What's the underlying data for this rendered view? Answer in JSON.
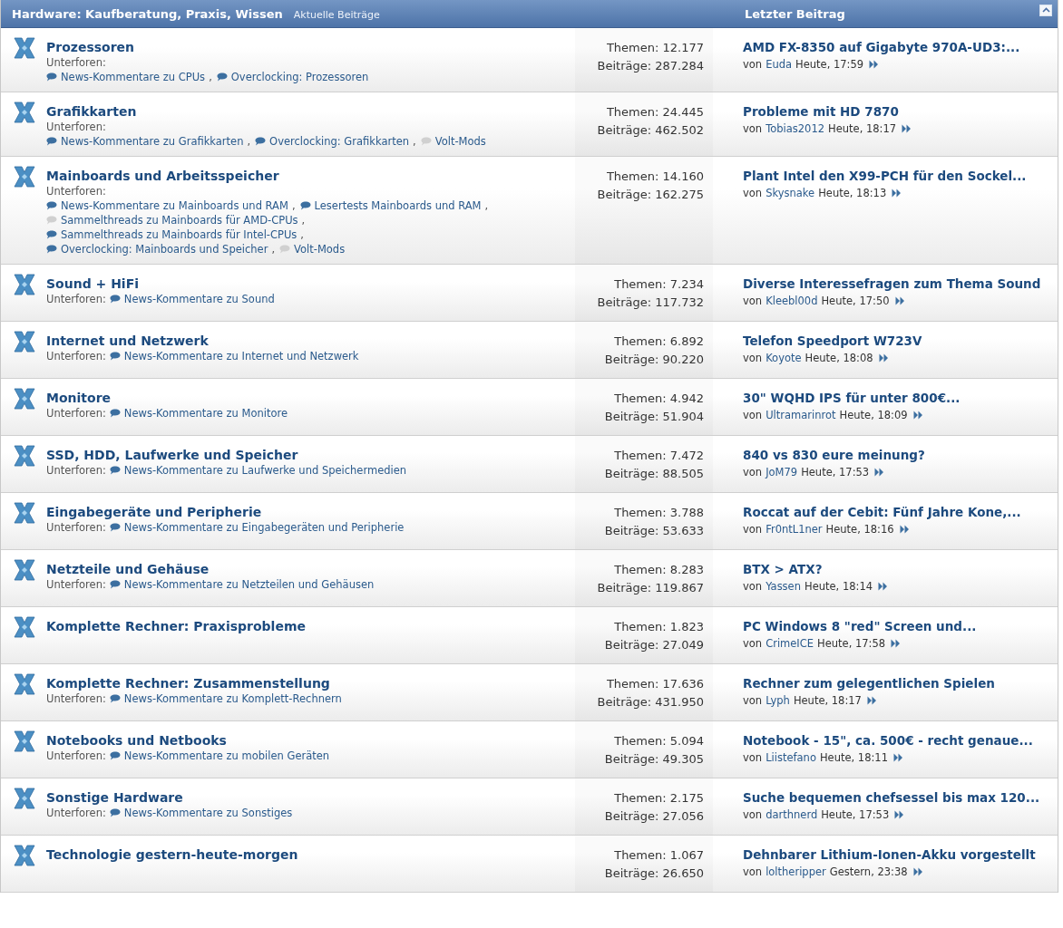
{
  "header": {
    "title": "Hardware: Kaufberatung, Praxis, Wissen",
    "link": "Aktuelle Beiträge",
    "last_post_heading": "Letzter Beitrag"
  },
  "forums": [
    {
      "name": "Prozessoren",
      "subforum_label": "Unterforen:",
      "label_on_own_line": true,
      "subforums": [
        {
          "name": "News-Kommentare zu CPUs",
          "unread": true,
          "separator": ","
        },
        {
          "name": "Overclocking: Prozessoren",
          "unread": true
        }
      ],
      "topics": "Themen: 12.177",
      "posts": "Beiträge: 287.284",
      "last_post": {
        "title": "AMD FX-8350 auf Gigabyte 970A-UD3:...",
        "by": "von",
        "author": "Euda",
        "time": "Heute, 17:59"
      }
    },
    {
      "name": "Grafikkarten",
      "subforum_label": "Unterforen:",
      "label_on_own_line": true,
      "subforums": [
        {
          "name": "News-Kommentare zu Grafikkarten",
          "unread": true,
          "separator": ","
        },
        {
          "name": "Overclocking: Grafikkarten",
          "unread": true,
          "separator": ","
        },
        {
          "name": "Volt-Mods",
          "unread": false
        }
      ],
      "topics": "Themen: 24.445",
      "posts": "Beiträge: 462.502",
      "last_post": {
        "title": "Probleme mit HD 7870",
        "by": "von",
        "author": "Tobias2012",
        "time": "Heute, 18:17"
      }
    },
    {
      "name": "Mainboards und Arbeitsspeicher",
      "subforum_label": "Unterforen:",
      "label_on_own_line": true,
      "subforums": [
        {
          "name": "News-Kommentare zu Mainboards und RAM",
          "unread": true,
          "separator": ","
        },
        {
          "name": "Lesertests Mainboards und RAM",
          "unread": true,
          "separator": ","
        },
        {
          "name": "Sammelthreads zu Mainboards für AMD-CPUs",
          "unread": false,
          "separator": ","
        },
        {
          "name": "Sammelthreads zu Mainboards für Intel-CPUs",
          "unread": true,
          "separator": ","
        },
        {
          "name": "Overclocking: Mainboards und Speicher",
          "unread": true,
          "separator": ","
        },
        {
          "name": "Volt-Mods",
          "unread": false
        }
      ],
      "topics": "Themen: 14.160",
      "posts": "Beiträge: 162.275",
      "last_post": {
        "title": "Plant Intel den X99-PCH für den Sockel...",
        "by": "von",
        "author": "Skysnake",
        "time": "Heute, 18:13"
      }
    },
    {
      "name": "Sound + HiFi",
      "subforum_label": "Unterforen:",
      "label_on_own_line": false,
      "subforums": [
        {
          "name": "News-Kommentare zu Sound",
          "unread": true
        }
      ],
      "topics": "Themen: 7.234",
      "posts": "Beiträge: 117.732",
      "last_post": {
        "title": "Diverse Interessefragen zum Thema Sound",
        "by": "von",
        "author": "Kleebl00d",
        "time": "Heute, 17:50"
      }
    },
    {
      "name": "Internet und Netzwerk",
      "subforum_label": "Unterforen:",
      "label_on_own_line": false,
      "subforums": [
        {
          "name": "News-Kommentare zu Internet und Netzwerk",
          "unread": true
        }
      ],
      "topics": "Themen: 6.892",
      "posts": "Beiträge: 90.220",
      "last_post": {
        "title": "Telefon Speedport W723V",
        "by": "von",
        "author": "Koyote",
        "time": "Heute, 18:08"
      }
    },
    {
      "name": "Monitore",
      "subforum_label": "Unterforen:",
      "label_on_own_line": false,
      "subforums": [
        {
          "name": "News-Kommentare zu Monitore",
          "unread": true
        }
      ],
      "topics": "Themen: 4.942",
      "posts": "Beiträge: 51.904",
      "last_post": {
        "title": "30\" WQHD IPS für unter 800€...",
        "by": "von",
        "author": "Ultramarinrot",
        "time": "Heute, 18:09"
      }
    },
    {
      "name": "SSD, HDD, Laufwerke und Speicher",
      "subforum_label": "Unterforen:",
      "label_on_own_line": false,
      "subforums": [
        {
          "name": "News-Kommentare zu Laufwerke und Speichermedien",
          "unread": true
        }
      ],
      "topics": "Themen: 7.472",
      "posts": "Beiträge: 88.505",
      "last_post": {
        "title": "840 vs 830 eure meinung?",
        "by": "von",
        "author": "JoM79",
        "time": "Heute, 17:53"
      }
    },
    {
      "name": "Eingabegeräte und Peripherie",
      "subforum_label": "Unterforen:",
      "label_on_own_line": false,
      "subforums": [
        {
          "name": "News-Kommentare zu Eingabegeräten und Peripherie",
          "unread": true
        }
      ],
      "topics": "Themen: 3.788",
      "posts": "Beiträge: 53.633",
      "last_post": {
        "title": "Roccat auf der Cebit: Fünf Jahre Kone,...",
        "by": "von",
        "author": "Fr0ntL1ner",
        "time": "Heute, 18:16"
      }
    },
    {
      "name": "Netzteile und Gehäuse",
      "subforum_label": "Unterforen:",
      "label_on_own_line": false,
      "subforums": [
        {
          "name": "News-Kommentare zu Netzteilen und Gehäusen",
          "unread": true
        }
      ],
      "topics": "Themen: 8.283",
      "posts": "Beiträge: 119.867",
      "last_post": {
        "title": "BTX > ATX?",
        "by": "von",
        "author": "Yassen",
        "time": "Heute, 18:14"
      }
    },
    {
      "name": "Komplette Rechner: Praxisprobleme",
      "topics": "Themen: 1.823",
      "posts": "Beiträge: 27.049",
      "last_post": {
        "title": "PC Windows 8 \"red\" Screen und...",
        "by": "von",
        "author": "CrimeICE",
        "time": "Heute, 17:58"
      }
    },
    {
      "name": "Komplette Rechner: Zusammenstellung",
      "subforum_label": "Unterforen:",
      "label_on_own_line": false,
      "subforums": [
        {
          "name": "News-Kommentare zu Komplett-Rechnern",
          "unread": true
        }
      ],
      "topics": "Themen: 17.636",
      "posts": "Beiträge: 431.950",
      "last_post": {
        "title": "Rechner zum gelegentlichen Spielen",
        "by": "von",
        "author": "Lyph",
        "time": "Heute, 18:17"
      }
    },
    {
      "name": "Notebooks und Netbooks",
      "subforum_label": "Unterforen:",
      "label_on_own_line": false,
      "subforums": [
        {
          "name": "News-Kommentare zu mobilen Geräten",
          "unread": true
        }
      ],
      "topics": "Themen: 5.094",
      "posts": "Beiträge: 49.305",
      "last_post": {
        "title": "Notebook - 15\", ca. 500€ - recht genaue...",
        "by": "von",
        "author": "Liistefano",
        "time": "Heute, 18:11"
      }
    },
    {
      "name": "Sonstige Hardware",
      "subforum_label": "Unterforen:",
      "label_on_own_line": false,
      "subforums": [
        {
          "name": "News-Kommentare zu Sonstiges",
          "unread": true
        }
      ],
      "topics": "Themen: 2.175",
      "posts": "Beiträge: 27.056",
      "last_post": {
        "title": "Suche bequemen chefsessel bis max 120...",
        "by": "von",
        "author": "darthnerd",
        "time": "Heute, 17:53"
      }
    },
    {
      "name": "Technologie gestern-heute-morgen",
      "topics": "Themen: 1.067",
      "posts": "Beiträge: 26.650",
      "last_post": {
        "title": "Dehnbarer Lithium-Ionen-Akku vorgestellt",
        "by": "von",
        "author": "loltheripper",
        "time": "Gestern, 23:38"
      }
    }
  ]
}
